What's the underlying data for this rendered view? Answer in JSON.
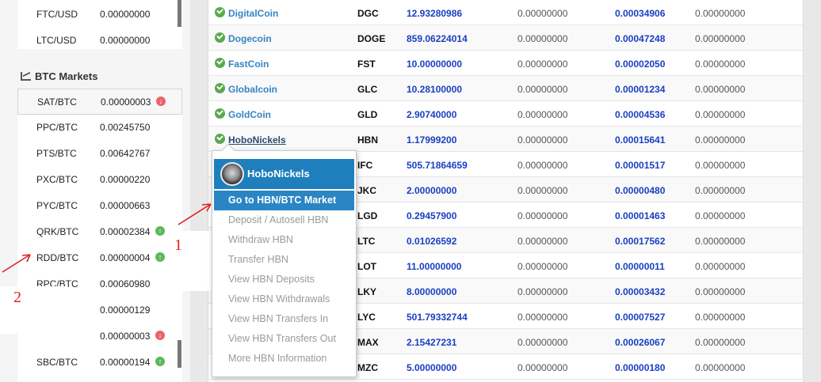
{
  "usd_markets": [
    {
      "pair": "FTC/USD",
      "price": "0.00000000"
    },
    {
      "pair": "LTC/USD",
      "price": "0.00000000"
    }
  ],
  "btc_markets": {
    "heading": "BTC Markets",
    "rows": [
      {
        "pair": "SAT/BTC",
        "price": "0.00000003",
        "trend": "down"
      },
      {
        "pair": "PPC/BTC",
        "price": "0.00245750",
        "trend": ""
      },
      {
        "pair": "PTS/BTC",
        "price": "0.00642767",
        "trend": ""
      },
      {
        "pair": "PXC/BTC",
        "price": "0.00000220",
        "trend": ""
      },
      {
        "pair": "PYC/BTC",
        "price": "0.00000663",
        "trend": ""
      },
      {
        "pair": "QRK/BTC",
        "price": "0.00002384",
        "trend": "up"
      },
      {
        "pair": "RDD/BTC",
        "price": "0.00000004",
        "trend": "up"
      },
      {
        "pair": "RPC/BTC",
        "price": "0.00060980",
        "trend": ""
      },
      {
        "pair": "",
        "price": "0.00000129",
        "trend": ""
      },
      {
        "pair": "",
        "price": "0.00000003",
        "trend": "down"
      },
      {
        "pair": "SBC/BTC",
        "price": "0.00000194",
        "trend": "up"
      }
    ]
  },
  "coins": [
    {
      "name": "DigitalCoin",
      "symbol": "DGC",
      "balance": "12.93280986",
      "z1": "0.00000000",
      "btc": "0.00034906",
      "z2": "0.00000000"
    },
    {
      "name": "Dogecoin",
      "symbol": "DOGE",
      "balance": "859.06224014",
      "z1": "0.00000000",
      "btc": "0.00047248",
      "z2": "0.00000000"
    },
    {
      "name": "FastCoin",
      "symbol": "FST",
      "balance": "10.00000000",
      "z1": "0.00000000",
      "btc": "0.00002050",
      "z2": "0.00000000"
    },
    {
      "name": "Globalcoin",
      "symbol": "GLC",
      "balance": "10.28100000",
      "z1": "0.00000000",
      "btc": "0.00001234",
      "z2": "0.00000000"
    },
    {
      "name": "GoldCoin",
      "symbol": "GLD",
      "balance": "2.90740000",
      "z1": "0.00000000",
      "btc": "0.00004536",
      "z2": "0.00000000"
    },
    {
      "name": "HoboNickels",
      "symbol": "HBN",
      "balance": "1.17999200",
      "z1": "0.00000000",
      "btc": "0.00015641",
      "z2": "0.00000000"
    },
    {
      "name": "",
      "symbol": "IFC",
      "balance": "505.71864659",
      "z1": "0.00000000",
      "btc": "0.00001517",
      "z2": "0.00000000"
    },
    {
      "name": "",
      "symbol": "JKC",
      "balance": "2.00000000",
      "z1": "0.00000000",
      "btc": "0.00000480",
      "z2": "0.00000000"
    },
    {
      "name": "",
      "symbol": "LGD",
      "balance": "0.29457900",
      "z1": "0.00000000",
      "btc": "0.00001463",
      "z2": "0.00000000"
    },
    {
      "name": "",
      "symbol": "LTC",
      "balance": "0.01026592",
      "z1": "0.00000000",
      "btc": "0.00017562",
      "z2": "0.00000000"
    },
    {
      "name": "",
      "symbol": "LOT",
      "balance": "11.00000000",
      "z1": "0.00000000",
      "btc": "0.00000011",
      "z2": "0.00000000"
    },
    {
      "name": "",
      "symbol": "LKY",
      "balance": "8.00000000",
      "z1": "0.00000000",
      "btc": "0.00003432",
      "z2": "0.00000000"
    },
    {
      "name": "",
      "symbol": "LYC",
      "balance": "501.79332744",
      "z1": "0.00000000",
      "btc": "0.00007527",
      "z2": "0.00000000"
    },
    {
      "name": "",
      "symbol": "MAX",
      "balance": "2.15427231",
      "z1": "0.00000000",
      "btc": "0.00026067",
      "z2": "0.00000000"
    },
    {
      "name": "",
      "symbol": "MZC",
      "balance": "5.00000000",
      "z1": "0.00000000",
      "btc": "0.00000180",
      "z2": "0.00000000"
    }
  ],
  "context_menu": {
    "title": "HoboNickels",
    "items": [
      "Go to HBN/BTC Market",
      "Deposit / Autosell HBN",
      "Withdraw HBN",
      "Transfer HBN",
      "View HBN Deposits",
      "View HBN Withdrawals",
      "View HBN Transfers In",
      "View HBN Transfers Out",
      "More HBN Information"
    ]
  },
  "annotations": {
    "step1": "1",
    "step2": "2",
    "color": "#e02020"
  },
  "colors": {
    "accent": "#1f7fbd",
    "link": "#3584c3",
    "value_blue": "#1a3fc2",
    "up": "#5cb85c",
    "down": "#e8646c"
  }
}
